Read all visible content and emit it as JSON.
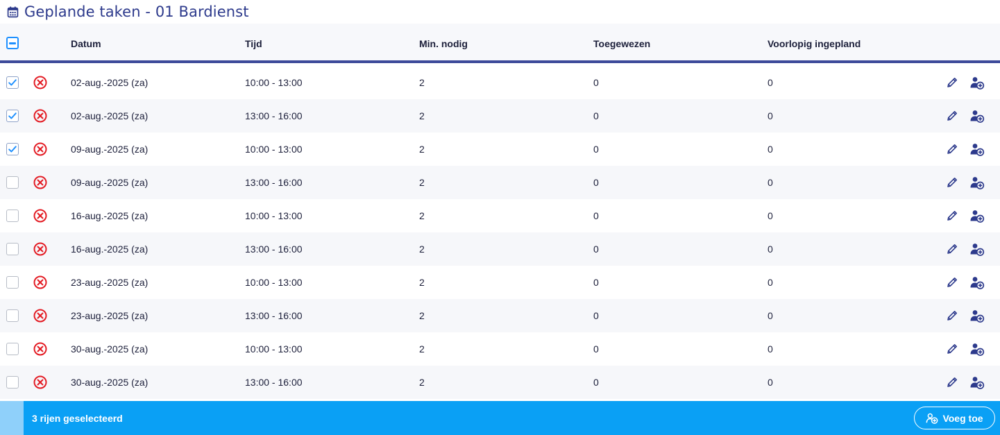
{
  "page": {
    "title": "Geplande taken - 01 Bardienst",
    "title_icon": "calendar-icon"
  },
  "table": {
    "select_all_state": "partial",
    "headers": {
      "datum": "Datum",
      "tijd": "Tijd",
      "min_nodig": "Min. nodig",
      "toegewezen": "Toegewezen",
      "voorlopig_ingepland": "Voorlopig ingepland"
    },
    "rows": [
      {
        "checked": true,
        "datum": "02-aug.-2025 (za)",
        "tijd": "10:00 - 13:00",
        "min_nodig": "2",
        "toegewezen": "0",
        "voorlopig_ingepland": "0"
      },
      {
        "checked": true,
        "datum": "02-aug.-2025 (za)",
        "tijd": "13:00 - 16:00",
        "min_nodig": "2",
        "toegewezen": "0",
        "voorlopig_ingepland": "0"
      },
      {
        "checked": true,
        "datum": "09-aug.-2025 (za)",
        "tijd": "10:00 - 13:00",
        "min_nodig": "2",
        "toegewezen": "0",
        "voorlopig_ingepland": "0"
      },
      {
        "checked": false,
        "datum": "09-aug.-2025 (za)",
        "tijd": "13:00 - 16:00",
        "min_nodig": "2",
        "toegewezen": "0",
        "voorlopig_ingepland": "0"
      },
      {
        "checked": false,
        "datum": "16-aug.-2025 (za)",
        "tijd": "10:00 - 13:00",
        "min_nodig": "2",
        "toegewezen": "0",
        "voorlopig_ingepland": "0"
      },
      {
        "checked": false,
        "datum": "16-aug.-2025 (za)",
        "tijd": "13:00 - 16:00",
        "min_nodig": "2",
        "toegewezen": "0",
        "voorlopig_ingepland": "0"
      },
      {
        "checked": false,
        "datum": "23-aug.-2025 (za)",
        "tijd": "10:00 - 13:00",
        "min_nodig": "2",
        "toegewezen": "0",
        "voorlopig_ingepland": "0"
      },
      {
        "checked": false,
        "datum": "23-aug.-2025 (za)",
        "tijd": "13:00 - 16:00",
        "min_nodig": "2",
        "toegewezen": "0",
        "voorlopig_ingepland": "0"
      },
      {
        "checked": false,
        "datum": "30-aug.-2025 (za)",
        "tijd": "10:00 - 13:00",
        "min_nodig": "2",
        "toegewezen": "0",
        "voorlopig_ingepland": "0"
      },
      {
        "checked": false,
        "datum": "30-aug.-2025 (za)",
        "tijd": "13:00 - 16:00",
        "min_nodig": "2",
        "toegewezen": "0",
        "voorlopig_ingepland": "0"
      }
    ],
    "row_icons": {
      "delete": "x-circle-icon",
      "edit": "pencil-icon",
      "assign": "add-person-icon"
    }
  },
  "footer": {
    "selection_text": "3 rijen geselecteerd",
    "add_button_label": "Voeg toe",
    "add_button_icon": "add-person-icon"
  },
  "colors": {
    "accent_blue": "#0aa0f5",
    "title_navy": "#2d3a8c",
    "header_rule": "#3d4a9a",
    "delete_red": "#e31b23",
    "checkbox_blue": "#1e90ff"
  }
}
